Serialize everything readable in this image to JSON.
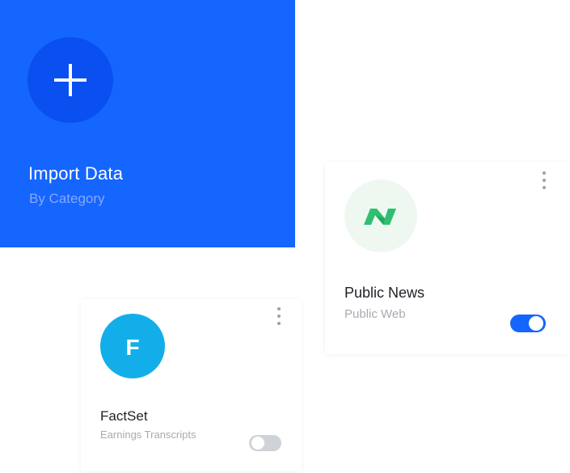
{
  "colors": {
    "accent": "#1565ff",
    "factset_logo": "#12aeea",
    "news_logo_bg": "#eef8f1",
    "news_logo_mark": "#2fbf71"
  },
  "import_card": {
    "title": "Import Data",
    "subtitle": "By Category",
    "icon": "plus-icon"
  },
  "sources": [
    {
      "title": "Public News",
      "subtitle": "Public Web",
      "logo_icon": "public-news-logo",
      "enabled": true
    },
    {
      "title": "FactSet",
      "subtitle": "Earnings Transcripts",
      "logo_icon": "factset-logo",
      "logo_letter": "F",
      "enabled": false
    }
  ]
}
